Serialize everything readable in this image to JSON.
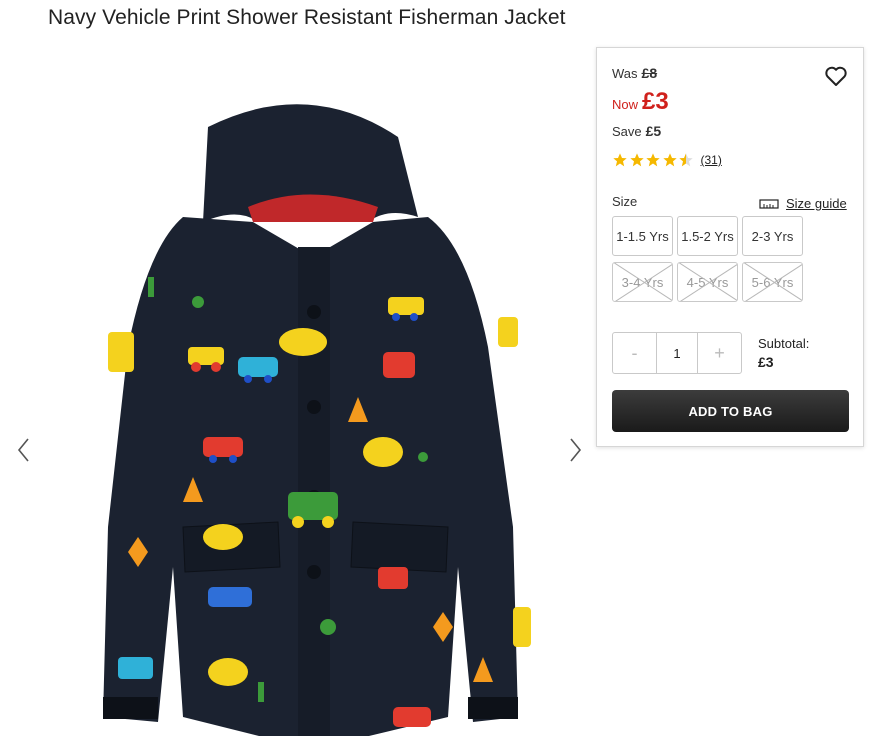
{
  "product": {
    "title": "Navy Vehicle Print Shower Resistant Fisherman Jacket"
  },
  "pricing": {
    "was_label": "Was",
    "was_price": "£8",
    "now_label": "Now",
    "now_price": "£3",
    "save_label": "Save",
    "save_amount": "£5"
  },
  "rating": {
    "stars": 4.5,
    "max": 5,
    "review_count": "(31)"
  },
  "size": {
    "label": "Size",
    "guide_label": "Size guide",
    "options": [
      {
        "label": "1-1.5 Yrs",
        "available": true
      },
      {
        "label": "1.5-2 Yrs",
        "available": true
      },
      {
        "label": "2-3 Yrs",
        "available": true
      },
      {
        "label": "3-4 Yrs",
        "available": false
      },
      {
        "label": "4-5 Yrs",
        "available": false
      },
      {
        "label": "5-6 Yrs",
        "available": false
      }
    ]
  },
  "quantity": {
    "minus": "-",
    "value": "1",
    "plus": "+"
  },
  "subtotal": {
    "label": "Subtotal:",
    "value": "£3"
  },
  "cta": {
    "add_to_bag": "ADD TO BAG"
  },
  "colors": {
    "sale_red": "#d0211c",
    "star_gold": "#f5b800",
    "jacket_navy": "#1b2230"
  }
}
